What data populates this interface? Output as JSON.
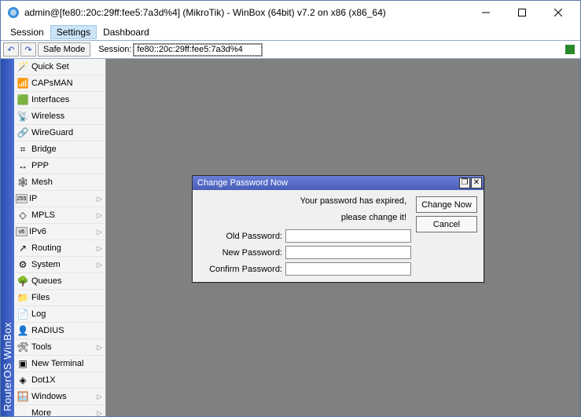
{
  "title": "admin@[fe80::20c:29ff:fee5:7a3d%4] (MikroTik) - WinBox (64bit) v7.2 on x86 (x86_64)",
  "menu": {
    "session": "Session",
    "settings": "Settings",
    "dashboard": "Dashboard"
  },
  "toolbar": {
    "undo": "↶",
    "redo": "↷",
    "safemode": "Safe Mode",
    "session_label": "Session:",
    "session_value": "fe80::20c:29ff:fee5:7a3d%4"
  },
  "sidestrip": "RouterOS WinBox",
  "sidebar": [
    {
      "icon": "🪄",
      "label": "Quick Set",
      "arrow": false
    },
    {
      "icon": "📶",
      "label": "CAPsMAN",
      "arrow": false
    },
    {
      "icon": "🟩",
      "label": "Interfaces",
      "arrow": false
    },
    {
      "icon": "📡",
      "label": "Wireless",
      "arrow": false
    },
    {
      "icon": "🔗",
      "label": "WireGuard",
      "arrow": false
    },
    {
      "icon": "⌗",
      "label": "Bridge",
      "arrow": false
    },
    {
      "icon": "↔",
      "label": "PPP",
      "arrow": false
    },
    {
      "icon": "🕸",
      "label": "Mesh",
      "arrow": false
    },
    {
      "icon": "255",
      "label": "IP",
      "arrow": true
    },
    {
      "icon": "◇",
      "label": "MPLS",
      "arrow": true
    },
    {
      "icon": "v6",
      "label": "IPv6",
      "arrow": true
    },
    {
      "icon": "↗",
      "label": "Routing",
      "arrow": true
    },
    {
      "icon": "⚙",
      "label": "System",
      "arrow": true
    },
    {
      "icon": "🌳",
      "label": "Queues",
      "arrow": false
    },
    {
      "icon": "📁",
      "label": "Files",
      "arrow": false
    },
    {
      "icon": "📄",
      "label": "Log",
      "arrow": false
    },
    {
      "icon": "👤",
      "label": "RADIUS",
      "arrow": false
    },
    {
      "icon": "🛠",
      "label": "Tools",
      "arrow": true
    },
    {
      "icon": "▣",
      "label": "New Terminal",
      "arrow": false
    },
    {
      "icon": "◈",
      "label": "Dot1X",
      "arrow": false
    },
    {
      "icon": "🪟",
      "label": "Windows",
      "arrow": true
    },
    {
      "icon": "",
      "label": "More",
      "arrow": true
    }
  ],
  "dialog": {
    "title": "Change Password Now",
    "msg1": "Your password has expired,",
    "msg2": "please change it!",
    "old_label": "Old Password:",
    "new_label": "New Password:",
    "confirm_label": "Confirm Password:",
    "change_btn": "Change Now",
    "cancel_btn": "Cancel",
    "restore": "❐",
    "close": "✕"
  }
}
